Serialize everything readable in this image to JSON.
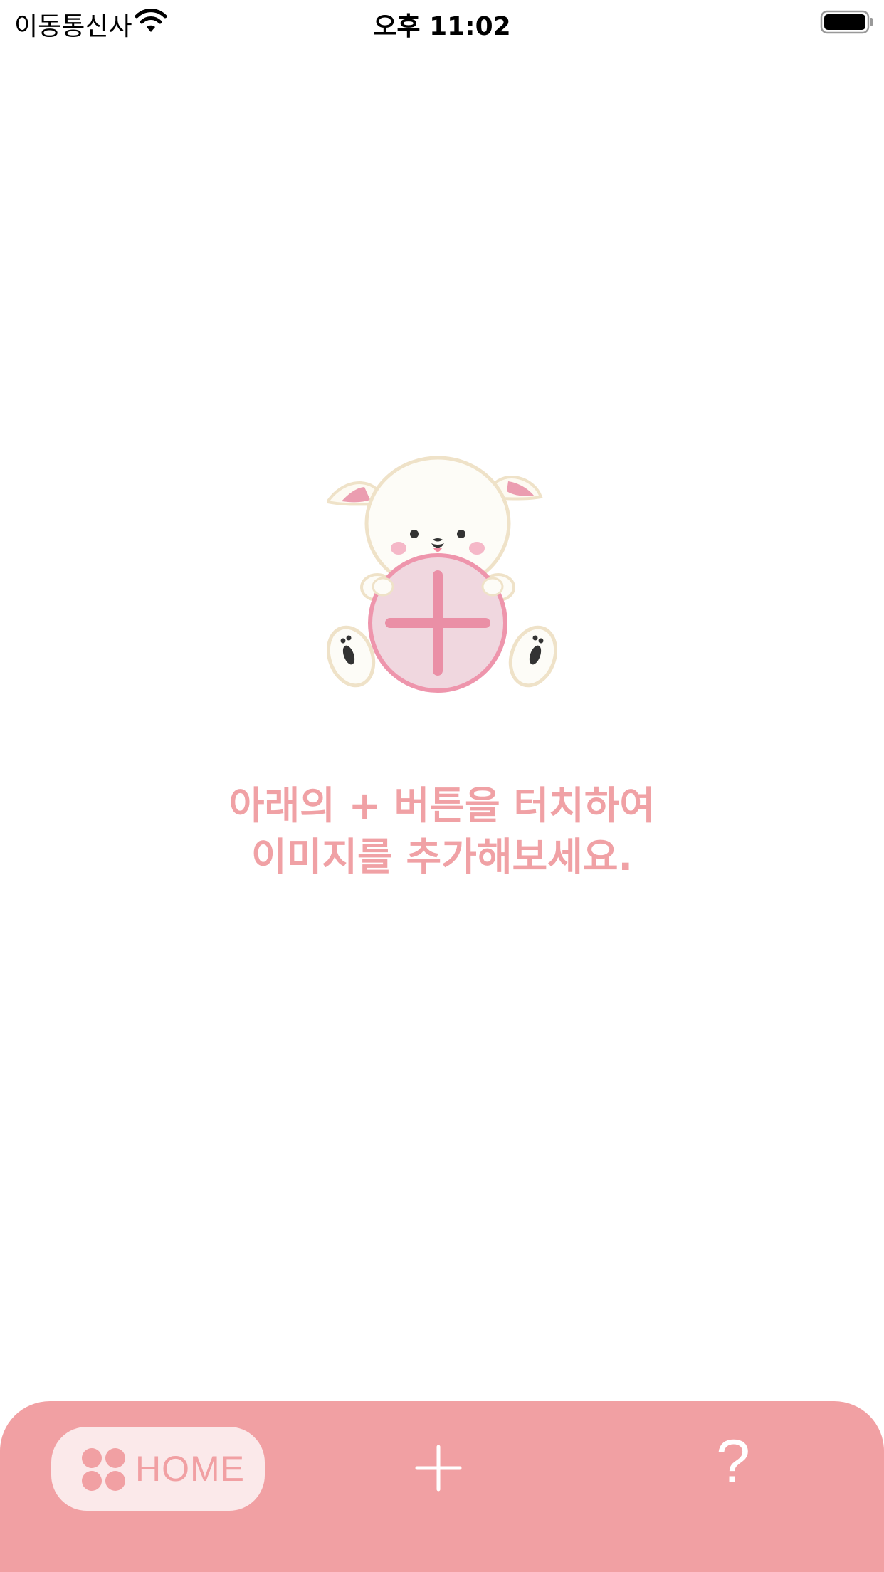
{
  "status_bar": {
    "carrier": "이동통신사",
    "time": "오후 11:02",
    "wifi_icon": "wifi-icon",
    "battery_icon": "battery-icon"
  },
  "main": {
    "mascot_icon": "rabbit-holding-plus-icon",
    "empty_message": {
      "line1": "아래의 + 버튼을 터치하여",
      "line2": "이미지를 추가해보세요."
    }
  },
  "tab_bar": {
    "home": {
      "label": "HOME",
      "icon": "four-dots-icon",
      "selected": true
    },
    "add": {
      "icon": "plus-icon"
    },
    "help": {
      "label": "?",
      "icon": "question-icon"
    }
  },
  "colors": {
    "accent": "#f1a0a3",
    "accent_light": "#fbe9ea",
    "message_text": "#f0a1a5"
  }
}
